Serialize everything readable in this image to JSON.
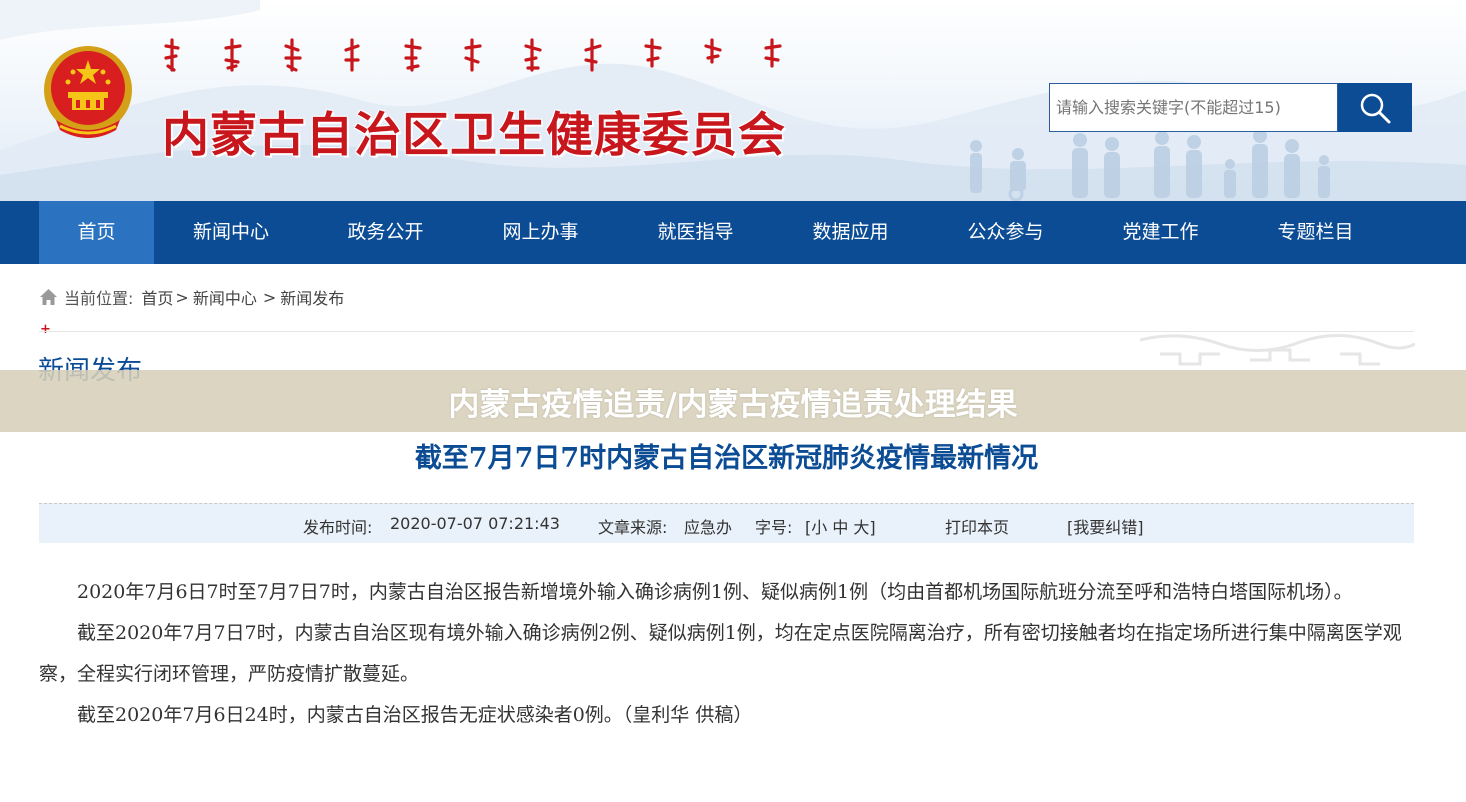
{
  "header": {
    "site_title": "内蒙古自治区卫生健康委员会",
    "search_placeholder": "请输入搜索关键字(不能超过15)",
    "search_button_icon": "search-icon"
  },
  "colors": {
    "brand_blue": "#0b4c95",
    "nav_active": "#2b73c0",
    "title_red": "#c8161d",
    "meta_bar_bg": "#e9f2fa",
    "banner_bg": "#d6cfb8"
  },
  "nav": {
    "items": [
      {
        "label": "首页",
        "active": true
      },
      {
        "label": "新闻中心",
        "active": false
      },
      {
        "label": "政务公开",
        "active": false
      },
      {
        "label": "网上办事",
        "active": false
      },
      {
        "label": "就医指导",
        "active": false
      },
      {
        "label": "数据应用",
        "active": false
      },
      {
        "label": "公众参与",
        "active": false
      },
      {
        "label": "党建工作",
        "active": false
      },
      {
        "label": "专题栏目",
        "active": false
      }
    ]
  },
  "breadcrumb": {
    "prefix": "当前位置:",
    "items": [
      "首页",
      "新闻中心",
      "新闻发布"
    ],
    "separator": ">"
  },
  "section": {
    "title": "新闻发布",
    "marker": "+"
  },
  "banner": {
    "text": "内蒙古疫情追责/内蒙古疫情追责处理结果"
  },
  "article": {
    "title": "截至7月7日7时内蒙古自治区新冠肺炎疫情最新情况",
    "meta": {
      "publish_label": "发布时间:",
      "publish_time": "2020-07-07 07:21:43",
      "source_label": "文章来源:",
      "source": "应急办",
      "font_label": "字号:",
      "font_sizes": "[小 中 大]",
      "print": "打印本页",
      "report_error": "[我要纠错]"
    },
    "paragraphs": [
      "2020年7月6日7时至7月7日7时，内蒙古自治区报告新增境外输入确诊病例1例、疑似病例1例（均由首都机场国际航班分流至呼和浩特白塔国际机场）。",
      "截至2020年7月7日7时，内蒙古自治区现有境外输入确诊病例2例、疑似病例1例，均在定点医院隔离治疗，所有密切接触者均在指定场所进行集中隔离医学观察，全程实行闭环管理，严防疫情扩散蔓延。",
      "截至2020年7月6日24时，内蒙古自治区报告无症状感染者0例。（皇利华 供稿）"
    ]
  }
}
